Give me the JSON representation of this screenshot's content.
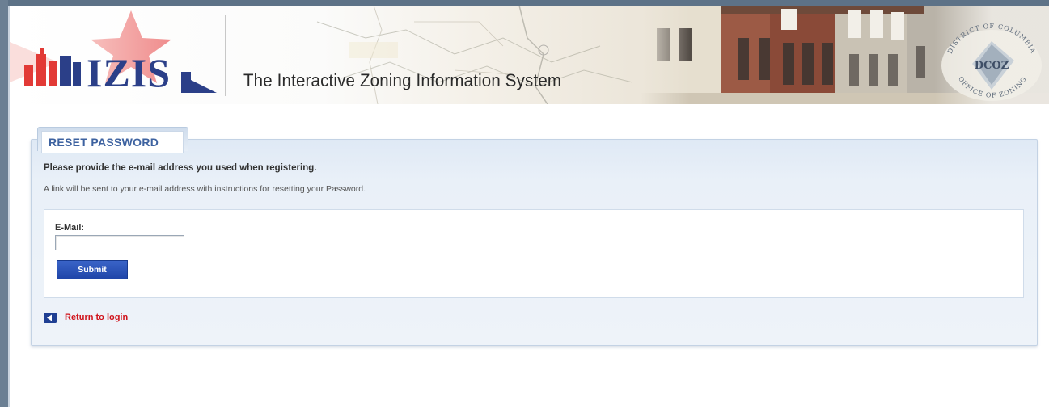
{
  "header": {
    "logo_text": "IZIS",
    "title": "The Interactive Zoning Information System",
    "seal": {
      "abbr": "DCOZ",
      "ring_top": "DISTRICT OF COLUMBIA",
      "ring_bottom": "OFFICE OF ZONING"
    }
  },
  "panel": {
    "tab_label": "RESET PASSWORD",
    "instruction_bold": "Please provide the e-mail address you used when registering.",
    "instruction_normal": "A link will be sent to your e-mail address with instructions for resetting your Password."
  },
  "form": {
    "email_label": "E-Mail:",
    "email_value": "",
    "submit_label": "Submit"
  },
  "links": {
    "return_label": "Return to login"
  },
  "icons": {
    "logo": "izis-logo-icon",
    "seal": "dcoz-seal-icon",
    "return": "back-arrow-icon"
  },
  "colors": {
    "brand_blue": "#2b3f88",
    "tab_text": "#3d62a0",
    "link_red": "#d0121b",
    "button_blue": "#2a52b8",
    "star_pink": "#ef8c8c"
  }
}
